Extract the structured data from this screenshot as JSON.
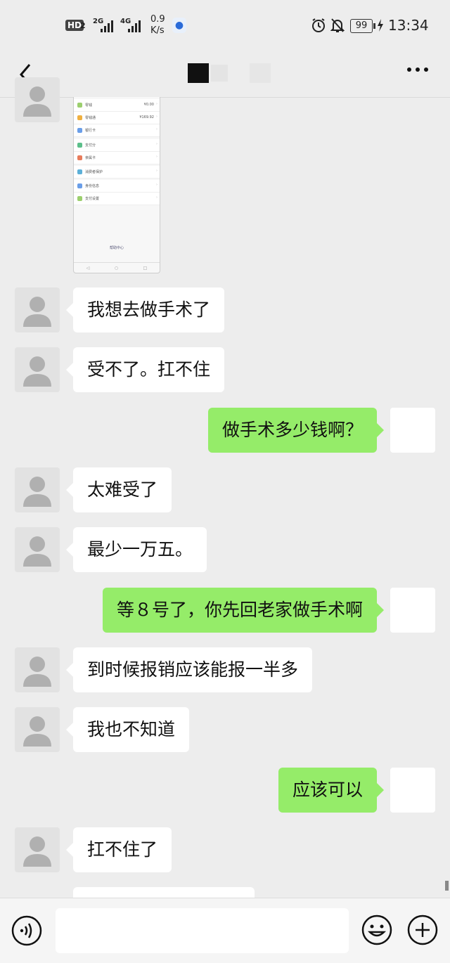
{
  "status_bar": {
    "hd_badge": "HD",
    "hd_sim": "2",
    "net_1": "2G",
    "net_2": "4G",
    "speed_value": "0.9",
    "speed_unit": "K/s",
    "battery": "99",
    "time": "13:34"
  },
  "screenshot_preview": {
    "rows": [
      {
        "label": "零钱",
        "value": "¥0.00"
      },
      {
        "label": "零钱通",
        "value": "¥169.92"
      },
      {
        "label": "银行卡",
        "value": ""
      },
      {
        "label": "支付分",
        "value": ""
      },
      {
        "label": "亲属卡",
        "value": ""
      },
      {
        "label": "消费者保护",
        "value": ""
      },
      {
        "label": "身份信息",
        "value": ""
      },
      {
        "label": "支付设置",
        "value": ""
      }
    ],
    "help": "帮助中心"
  },
  "messages": [
    {
      "side": "left",
      "text": "我想去做手术了"
    },
    {
      "side": "left",
      "text": "受不了。扛不住"
    },
    {
      "side": "right",
      "text": "做手术多少钱啊？"
    },
    {
      "side": "left",
      "text": "太难受了"
    },
    {
      "side": "left",
      "text": "最少一万五。"
    },
    {
      "side": "right",
      "text": "等８号了，你先回老家做手术啊"
    },
    {
      "side": "left",
      "text": "到时候报销应该能报一半多"
    },
    {
      "side": "left",
      "text": "我也不知道"
    },
    {
      "side": "right",
      "text": "应该可以"
    },
    {
      "side": "left",
      "text": "扛不住了"
    }
  ],
  "input": {
    "value": ""
  },
  "colors": {
    "sent_bubble": "#95ec69",
    "received_bubble": "#ffffff",
    "background": "#ededed"
  },
  "icons": [
    "back-arrow-icon",
    "more-icon",
    "voice-icon",
    "emoji-icon",
    "plus-icon",
    "alarm-icon",
    "mute-icon",
    "charging-icon"
  ]
}
